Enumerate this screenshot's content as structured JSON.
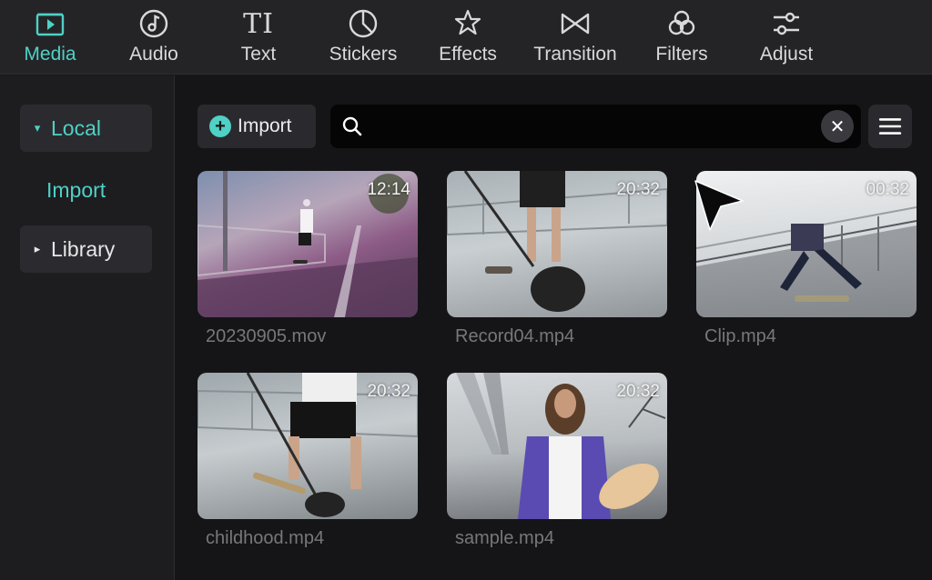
{
  "toolbar": {
    "tabs": [
      {
        "label": "Media",
        "icon": "media-icon"
      },
      {
        "label": "Audio",
        "icon": "audio-icon"
      },
      {
        "label": "Text",
        "icon": "text-icon"
      },
      {
        "label": "Stickers",
        "icon": "stickers-icon"
      },
      {
        "label": "Effects",
        "icon": "effects-icon"
      },
      {
        "label": "Transition",
        "icon": "transition-icon"
      },
      {
        "label": "Filters",
        "icon": "filters-icon"
      },
      {
        "label": "Adjust",
        "icon": "adjust-icon"
      }
    ],
    "active": "Media",
    "text_icon_glyph": "TI"
  },
  "sidebar": {
    "local": {
      "label": "Local",
      "caret": "▾"
    },
    "import": {
      "label": "Import"
    },
    "library": {
      "label": "Library",
      "caret": "▸"
    }
  },
  "main": {
    "import_button": {
      "label": "Import",
      "icon": "+"
    },
    "search": {
      "placeholder": "",
      "value": ""
    },
    "clear_icon": "✕",
    "media": [
      {
        "name": "20230905.mov",
        "duration": "12:14"
      },
      {
        "name": "Record04.mp4",
        "duration": "20:32"
      },
      {
        "name": "Clip.mp4",
        "duration": "00:32"
      },
      {
        "name": "childhood.mp4",
        "duration": "20:32"
      },
      {
        "name": "sample.mp4",
        "duration": "20:32"
      }
    ]
  },
  "colors": {
    "accent": "#4fd1c5",
    "toolbar_bg": "#242427",
    "sidebar_bg": "#1d1d20",
    "main_bg": "#151517",
    "filename": "#77777c"
  }
}
